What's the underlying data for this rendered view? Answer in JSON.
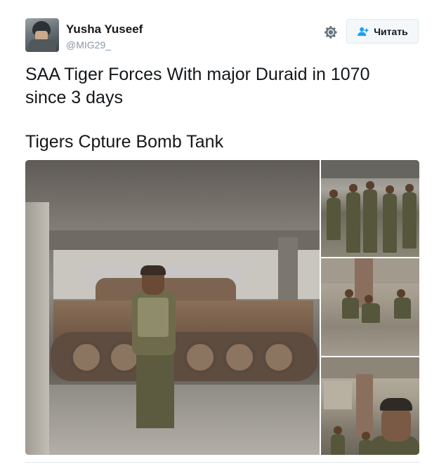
{
  "tweet": {
    "author": {
      "display_name": "Yusha Yuseef",
      "screen_name": "@MIG29_"
    },
    "follow_button_label": "Читать",
    "text_lines": [
      "SAA Tiger Forces With major Duraid in 1070",
      "since 3 days",
      "Tigers Cpture Bomb Tank"
    ],
    "icons": {
      "settings": "gear-icon",
      "follow": "follow-user-icon",
      "avatar": "avatar-image"
    },
    "media": {
      "photo_count": 4
    }
  },
  "colors": {
    "text_primary": "#14171a",
    "text_secondary": "#8899a6",
    "button_bg": "#f5f8fa",
    "button_border": "#e1e8ed",
    "icon_blue": "#1da1f2",
    "gear_gray": "#66757f"
  }
}
